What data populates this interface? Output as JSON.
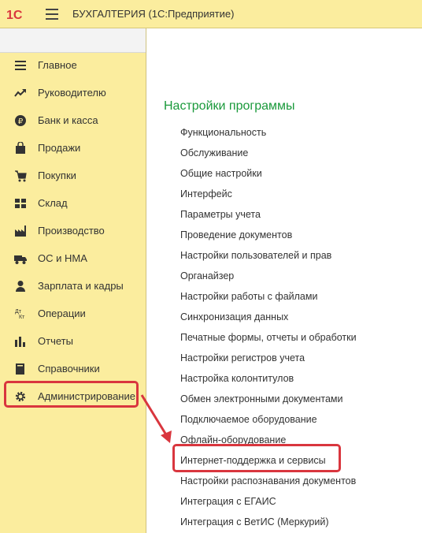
{
  "app": {
    "title": "БУХГАЛТЕРИЯ  (1С:Предприятие)",
    "logo_text": "1С"
  },
  "sidebar": {
    "items": [
      {
        "label": "Главное",
        "icon": "list-icon"
      },
      {
        "label": "Руководителю",
        "icon": "trend-icon"
      },
      {
        "label": "Банк и касса",
        "icon": "ruble-coin-icon"
      },
      {
        "label": "Продажи",
        "icon": "shopping-bag-icon"
      },
      {
        "label": "Покупки",
        "icon": "cart-icon"
      },
      {
        "label": "Склад",
        "icon": "warehouse-grid-icon"
      },
      {
        "label": "Производство",
        "icon": "factory-icon"
      },
      {
        "label": "ОС и НМА",
        "icon": "truck-icon"
      },
      {
        "label": "Зарплата и кадры",
        "icon": "person-icon"
      },
      {
        "label": "Операции",
        "icon": "dt-kt-icon"
      },
      {
        "label": "Отчеты",
        "icon": "bar-chart-icon"
      },
      {
        "label": "Справочники",
        "icon": "books-icon"
      },
      {
        "label": "Администрирование",
        "icon": "gear-icon"
      }
    ],
    "dt_kt": {
      "dt": "Дт",
      "kt": "Кт"
    }
  },
  "content": {
    "heading": "Настройки программы",
    "links": [
      "Функциональность",
      "Обслуживание",
      "Общие настройки",
      "Интерфейс",
      "Параметры учета",
      "Проведение документов",
      "Настройки пользователей и прав",
      "Органайзер",
      "Настройки работы с файлами",
      "Синхронизация данных",
      "Печатные формы, отчеты и обработки",
      "Настройки регистров учета",
      "Настройка колонтитулов",
      "Обмен электронными документами",
      "Подключаемое оборудование",
      "Офлайн-оборудование",
      "Интернет-поддержка и сервисы",
      "Настройки распознавания документов",
      "Интеграция с ЕГАИС",
      "Интеграция с ВетИС (Меркурий)"
    ]
  },
  "colors": {
    "sidebar_bg": "#fbed9e",
    "heading": "#1a9a3b",
    "highlight": "#d9363e"
  }
}
